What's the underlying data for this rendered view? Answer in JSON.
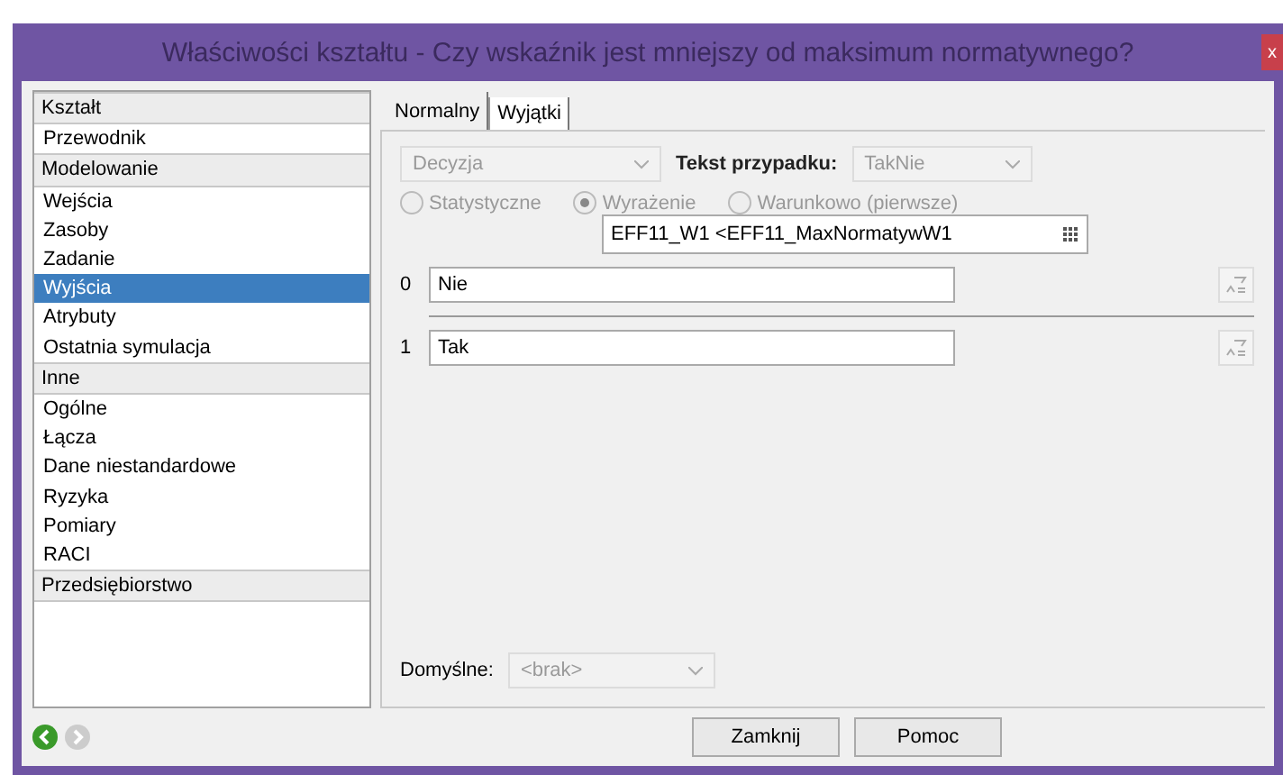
{
  "window": {
    "title": "Właściwości kształtu - Czy wskaźnik jest mniejszy od maksimum normatywnego?",
    "close": "x"
  },
  "sidebar": {
    "items": [
      {
        "kind": "header",
        "label": "Kształt",
        "selected": false
      },
      {
        "kind": "item",
        "label": "Przewodnik",
        "selected": false
      },
      {
        "kind": "header",
        "label": "Modelowanie",
        "selected": false
      },
      {
        "kind": "item",
        "label": "Wejścia",
        "selected": false
      },
      {
        "kind": "item",
        "label": "Zasoby",
        "selected": false
      },
      {
        "kind": "item",
        "label": "Zadanie",
        "selected": false
      },
      {
        "kind": "item",
        "label": "Wyjścia",
        "selected": true
      },
      {
        "kind": "item",
        "label": "Atrybuty",
        "selected": false
      },
      {
        "kind": "item",
        "label": "Ostatnia symulacja",
        "selected": false
      },
      {
        "kind": "header",
        "label": "Inne",
        "selected": false
      },
      {
        "kind": "item",
        "label": "Ogólne",
        "selected": false
      },
      {
        "kind": "item",
        "label": "Łącza",
        "selected": false
      },
      {
        "kind": "item",
        "label": "Dane niestandardowe",
        "selected": false
      },
      {
        "kind": "item",
        "label": "Ryzyka",
        "selected": false
      },
      {
        "kind": "item",
        "label": "Pomiary",
        "selected": false
      },
      {
        "kind": "item",
        "label": "RACI",
        "selected": false
      },
      {
        "kind": "header",
        "label": "Przedsiębiorstwo",
        "selected": false
      }
    ]
  },
  "tabs": [
    {
      "label": "Normalny",
      "selected": true
    },
    {
      "label": "Wyjątki",
      "selected": false
    }
  ],
  "type_select": {
    "value": "Decyzja",
    "disabled": true
  },
  "case_text": {
    "label": "Tekst przypadku:",
    "value": "TakNie",
    "disabled": true
  },
  "modes": [
    {
      "label": "Statystyczne",
      "selected": false,
      "disabled": true
    },
    {
      "label": "Wyrażenie",
      "selected": true,
      "disabled": true
    },
    {
      "label": "Warunkowo (pierwsze)",
      "selected": false,
      "disabled": true
    }
  ],
  "expression": {
    "value": "EFF11_W1 <EFF11_MaxNormatywW1"
  },
  "outputs": [
    {
      "index": "0",
      "value": "Nie"
    },
    {
      "index": "1",
      "value": "Tak"
    }
  ],
  "default": {
    "label": "Domyślne:",
    "value": "<brak>",
    "disabled": true
  },
  "buttons": [
    "Zamknij",
    "Pomoc"
  ]
}
